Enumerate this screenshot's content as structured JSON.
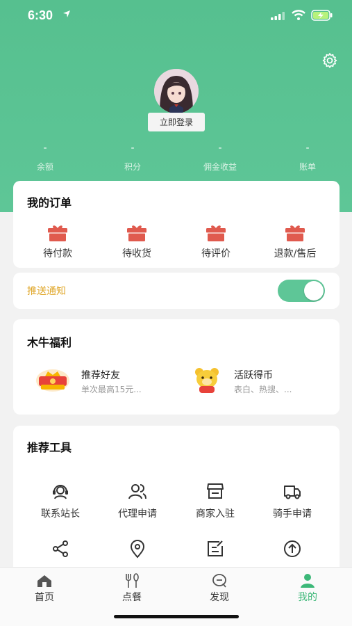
{
  "status_bar": {
    "time": "6:30"
  },
  "profile": {
    "login_label": "立即登录"
  },
  "stats": [
    {
      "value": "-",
      "label": "余额"
    },
    {
      "value": "-",
      "label": "积分"
    },
    {
      "value": "-",
      "label": "佣金收益"
    },
    {
      "value": "-",
      "label": "账单"
    }
  ],
  "orders": {
    "title": "我的订单",
    "items": [
      {
        "label": "待付款",
        "icon": "gift-box-icon"
      },
      {
        "label": "待收货",
        "icon": "gift-box-icon"
      },
      {
        "label": "待评价",
        "icon": "gift-box-icon"
      },
      {
        "label": "退款/售后",
        "icon": "gift-box-icon"
      }
    ]
  },
  "push": {
    "label": "推送通知",
    "enabled": true
  },
  "welfare": {
    "title": "木牛福利",
    "items": [
      {
        "title": "推荐好友",
        "subtitle": "单次最高15元...",
        "icon": "coupon-icon"
      },
      {
        "title": "活跃得币",
        "subtitle": "表白、热搜、...",
        "icon": "bear-icon"
      }
    ]
  },
  "tools": {
    "title": "推荐工具",
    "items": [
      {
        "label": "联系站长",
        "icon": "headset-icon"
      },
      {
        "label": "代理申请",
        "icon": "users-icon"
      },
      {
        "label": "商家入驻",
        "icon": "store-icon"
      },
      {
        "label": "骑手申请",
        "icon": "delivery-truck-icon"
      },
      {
        "label": "",
        "icon": "share-icon"
      },
      {
        "label": "",
        "icon": "location-pin-icon"
      },
      {
        "label": "",
        "icon": "edit-note-icon"
      },
      {
        "label": "",
        "icon": "upload-circle-icon"
      }
    ]
  },
  "tabbar": [
    {
      "label": "首页",
      "icon": "home-icon",
      "active": false
    },
    {
      "label": "点餐",
      "icon": "fork-knife-icon",
      "active": false
    },
    {
      "label": "发现",
      "icon": "discover-icon",
      "active": false
    },
    {
      "label": "我的",
      "icon": "profile-icon",
      "active": true
    }
  ],
  "colors": {
    "primary": "#5ec697",
    "accent_gift": "#e05a4e",
    "push_label": "#e0a72b",
    "active_tab": "#3cb878"
  }
}
